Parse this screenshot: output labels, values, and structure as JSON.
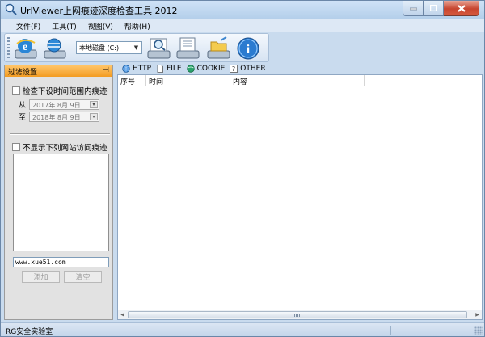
{
  "window": {
    "title": "UrlViewer上网痕迹深度检查工具 2012"
  },
  "menu": {
    "items": [
      "文件(F)",
      "工具(T)",
      "视图(V)",
      "帮助(H)"
    ]
  },
  "toolbar": {
    "drive_select": "本地磁盘 (C:)",
    "buttons": [
      "ie-history-icon",
      "disk-scan-icon",
      "magnifier-drive-icon",
      "document-drive-icon",
      "folder-drive-icon",
      "info-icon"
    ]
  },
  "filter_panel": {
    "title": "过滤设置",
    "date_check_label": "检查下设时间范围内痕迹",
    "from_label": "从",
    "to_label": "至",
    "from_date": "2017年 8月 9日",
    "to_date": "2018年 8月 9日",
    "exclude_check_label": "不显示下列网站访问痕迹",
    "site_input_value": "www.xue51.com",
    "add_button": "添加",
    "clear_button": "清空"
  },
  "tabs": [
    {
      "label": "HTTP",
      "icon": "globe-icon"
    },
    {
      "label": "FILE",
      "icon": "file-icon"
    },
    {
      "label": "COOKIE",
      "icon": "cookie-icon"
    },
    {
      "label": "OTHER",
      "icon": "help-icon"
    }
  ],
  "grid": {
    "columns": [
      "序号",
      "时间",
      "内容"
    ]
  },
  "status": {
    "text": "RG安全实验室"
  },
  "colors": {
    "panel_header": "#f39b21",
    "window_frame": "#c9dbee",
    "close_button": "#c7452f"
  }
}
